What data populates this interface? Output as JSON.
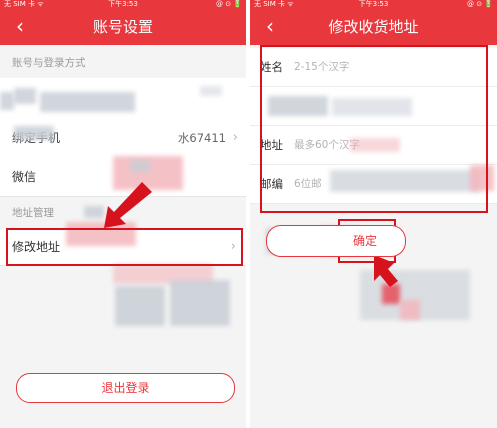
{
  "left": {
    "status": {
      "carrier": "无 SIM 卡 ᯤ",
      "time": "下午3:53",
      "right": "@ ⊙ 🔋"
    },
    "title": "账号设置",
    "back": "‹",
    "section_login": "账号与登录方式",
    "row_phone_label": "绑定手机",
    "row_phone_value": "水67411",
    "row_wechat_label": "微信",
    "section_address": "地址管理",
    "row_address_label": "修改地址",
    "chevron": "›",
    "logout": "退出登录"
  },
  "right": {
    "status": {
      "carrier": "无 SIM 卡 ᯤ",
      "time": "下午3:53",
      "right": "@ ⊙ 🔋"
    },
    "title": "修改收货地址",
    "back": "‹",
    "fields": [
      {
        "label": "姓名",
        "placeholder": "2-15个汉字"
      },
      {
        "label": "",
        "placeholder": ""
      },
      {
        "label": "地址",
        "placeholder": "最多60个汉字"
      },
      {
        "label": "邮编",
        "placeholder": "6位邮"
      }
    ],
    "confirm": "确定"
  },
  "colors": {
    "brand_red": "#e8383d",
    "annotation_red": "#d6121c",
    "background": "#f4f4f4"
  }
}
